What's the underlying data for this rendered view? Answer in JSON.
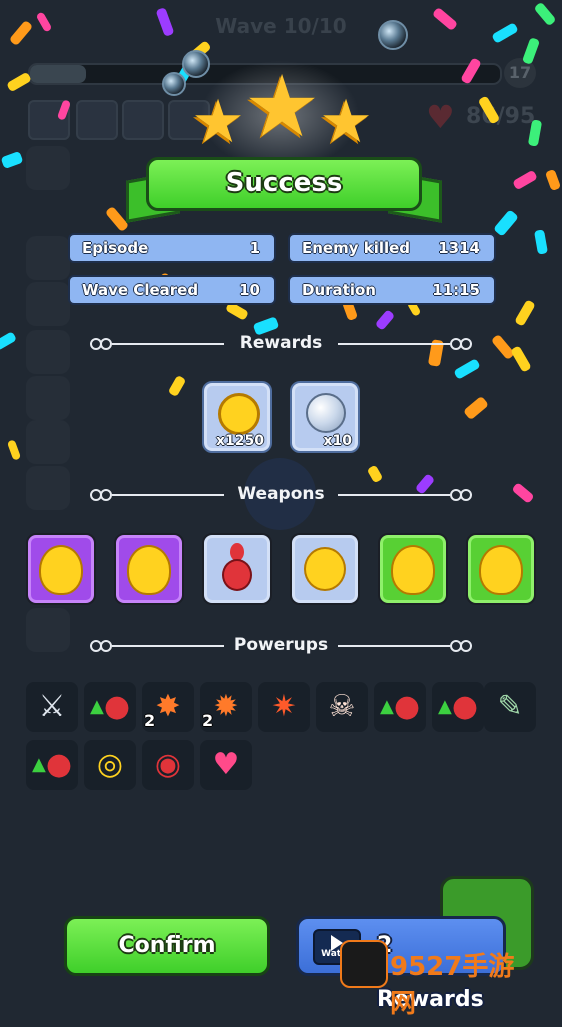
{
  "hud": {
    "wave": "Wave 10/10",
    "level": "17",
    "hp": "86/95"
  },
  "result": {
    "title": "Success",
    "stars": 3
  },
  "stats": {
    "episode_label": "Episode",
    "episode_value": "1",
    "enemy_killed_label": "Enemy killed",
    "enemy_killed_value": "1314",
    "wave_cleared_label": "Wave Cleared",
    "wave_cleared_value": "10",
    "duration_label": "Duration",
    "duration_value": "11:15"
  },
  "sections": {
    "rewards": "Rewards",
    "weapons": "Weapons",
    "powerups": "Powerups"
  },
  "rewards": [
    {
      "icon": "gold-coin-icon",
      "amount": "x1250"
    },
    {
      "icon": "pearl-orb-icon",
      "amount": "x10"
    }
  ],
  "weapons": [
    {
      "icon": "yellow-blob-weapon-icon",
      "rarity": "purple"
    },
    {
      "icon": "yellow-blob-weapon-icon",
      "rarity": "purple"
    },
    {
      "icon": "red-bowling-pin-icon",
      "rarity": "blue"
    },
    {
      "icon": "yellow-round-flask-icon",
      "rarity": "blue"
    },
    {
      "icon": "yellow-blob-weapon-icon",
      "rarity": "green"
    },
    {
      "icon": "yellow-blob-weapon-icon",
      "rarity": "green"
    }
  ],
  "powerups": [
    {
      "icon": "speed-sword-icon",
      "count": ""
    },
    {
      "icon": "pin-upgrade-icon",
      "count": ""
    },
    {
      "icon": "explosion-sword-plus-icon",
      "count": "2"
    },
    {
      "icon": "explosion-up-icon",
      "count": "2"
    },
    {
      "icon": "explosion-cross-icon",
      "count": ""
    },
    {
      "icon": "skull-icon",
      "count": ""
    },
    {
      "icon": "pin-pair-upgrade-icon",
      "count": ""
    },
    {
      "icon": "pin-pair-upgrade-icon",
      "count": ""
    },
    {
      "icon": "syringe-icon",
      "count": ""
    },
    {
      "icon": "pin-upgrade-icon",
      "count": ""
    },
    {
      "icon": "pin-target-icon",
      "count": ""
    },
    {
      "icon": "pin-target-red-icon",
      "count": ""
    },
    {
      "icon": "muscle-heart-icon",
      "count": ""
    }
  ],
  "buttons": {
    "confirm": "Confirm",
    "watch": "Watch",
    "rewards": "2 Rewards"
  },
  "watermark": "9527手游网",
  "colors": {
    "background": "#202832",
    "success_green": "#3fcf2a",
    "stat_blue": "#8fb6f2",
    "rarity_purple": "#a04bea",
    "rarity_blue": "#b7cbef",
    "rarity_green": "#58d034"
  }
}
